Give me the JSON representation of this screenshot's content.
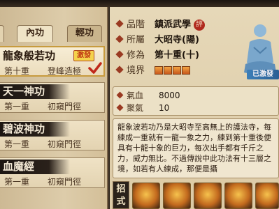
{
  "tabs": [
    {
      "label": "內功"
    },
    {
      "label": "輕功"
    }
  ],
  "skills": [
    {
      "name": "龍象般若功",
      "level": "第十重",
      "status": "登峰造極",
      "badge": "激發",
      "selected": true
    },
    {
      "name": "天一神功",
      "level": "第一重",
      "status": "初窺門徑",
      "selected": false
    },
    {
      "name": "碧波神功",
      "level": "第一重",
      "status": "初窺門徑",
      "selected": false
    },
    {
      "name": "血魔經",
      "level": "第一重",
      "status": "初窺門徑",
      "selected": false
    }
  ],
  "info": {
    "grade_label": "品階",
    "grade_value": "鎮派武學",
    "review_badge": "評",
    "sect_label": "所屬",
    "sect_value": "大昭寺(陽)",
    "cultivation_label": "修為",
    "cultivation_value": "第十重(十)",
    "boundary_label": "境界",
    "boundary_filled": 4,
    "boundary_total": 4
  },
  "portrait": {
    "activated_label": "已激發"
  },
  "stats": [
    {
      "label": "氣血",
      "value": "8000"
    },
    {
      "label": "聚氣",
      "value": "10"
    }
  ],
  "description": "龍象波若功乃是大昭寺至高無上的護法寺，每練成一重就有一龍一象之力，練到第十重後便具有十龍十象的巨力，每次出手都有千斤之力，威力無比。不過傳說中此功法有十三層之境，如若有人練成，那便是攝",
  "moves": {
    "label": "招式",
    "icons": [
      "move-1",
      "move-2",
      "move-3",
      "move-4",
      "move-5"
    ]
  },
  "colors": {
    "accent": "#c79b3e",
    "badge_red": "#b02a1e",
    "boundary_fill": "#e88a2c",
    "activated_blue": "#3d7fb8"
  }
}
